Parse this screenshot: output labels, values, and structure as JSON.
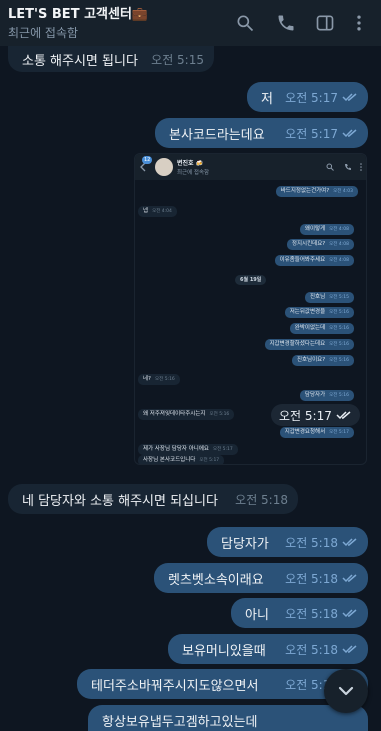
{
  "header": {
    "title": "LET'S BET 고객센터💼",
    "status": "최근에 접속함",
    "icons": [
      "search-icon",
      "phone-icon",
      "sidebar-toggle-icon",
      "more-vert-icon"
    ]
  },
  "messages": [
    {
      "text": "소통 해주시면 됩니다",
      "time": "오전 5:15",
      "dir": "in"
    },
    {
      "text": "저",
      "time": "오전 5:17",
      "dir": "out",
      "read": true
    },
    {
      "text": "본사코드라는데요",
      "time": "오전 5:17",
      "dir": "out",
      "read": true
    },
    {
      "text": "네 담당자와 소통 해주시면 되십니다",
      "time": "오전 5:18",
      "dir": "in"
    },
    {
      "text": "담당자가",
      "time": "오전 5:18",
      "dir": "out",
      "read": true
    },
    {
      "text": "렛츠벳소속이래요",
      "time": "오전 5:18",
      "dir": "out",
      "read": true
    },
    {
      "text": "아니",
      "time": "오전 5:18",
      "dir": "out",
      "read": true
    },
    {
      "text": "보유머니있을때",
      "time": "오전 5:18",
      "dir": "out",
      "read": true
    },
    {
      "text": "테더주소바꿔주시지도않으면서",
      "time": "오전 5:18",
      "dir": "out",
      "read": true
    },
    {
      "text": "항상보유냅두고겜하고있는데",
      "time": "",
      "dir": "out",
      "read": false
    }
  ],
  "screenshot_message": {
    "time": "오전 5:17",
    "header_name": "변진호 🍻",
    "header_status": "최근에 접속함",
    "avatar_badge": "12",
    "date_label": "6월 19일",
    "items": [
      {
        "text": "바드지정없는건가여?",
        "time": "오전 4:03",
        "dir": "o"
      },
      {
        "text": "넵",
        "time": "오전 4:04",
        "dir": "i"
      },
      {
        "text": "왜이렇게",
        "time": "오전 4:08",
        "dir": "o"
      },
      {
        "text": "정지시킨데요?",
        "time": "오전 4:08",
        "dir": "o"
      },
      {
        "text": "이유좀들어봐주세요",
        "time": "오전 4:08",
        "dir": "o"
      },
      {
        "text": "진호님",
        "time": "오전 5:15",
        "dir": "o"
      },
      {
        "text": "저는뒤값변경을",
        "time": "오전 5:16",
        "dir": "o"
      },
      {
        "text": "완박이없는데",
        "time": "오전 5:16",
        "dir": "o"
      },
      {
        "text": "지갑변경할하셨다는데요",
        "time": "오전 5:16",
        "dir": "o"
      },
      {
        "text": "진호님이요?",
        "time": "오전 5:16",
        "dir": "o"
      },
      {
        "text": "네?",
        "time": "오전 5:16",
        "dir": "i"
      },
      {
        "text": "담당자가",
        "time": "오전 5:16",
        "dir": "o"
      },
      {
        "text": "왜 저주져잊데이타주시는지",
        "time": "오전 5:16",
        "dir": "i"
      },
      {
        "text": "지갑변경요청해서",
        "time": "오전 5:17",
        "dir": "o"
      },
      {
        "text": "제가 사장님 담당자 아니에요",
        "time": "오전 5:17",
        "dir": "i"
      },
      {
        "text": "사장님 본사코드입니다",
        "time": "오전 5:17",
        "dir": "i"
      }
    ]
  },
  "colors": {
    "background": "#0e1621",
    "header": "#17212b",
    "incoming_bubble": "#182533",
    "outgoing_bubble": "#2b5278",
    "time_outgoing": "#7da8d3",
    "time_incoming": "#6d7f8f"
  },
  "scroll_button_icon": "chevron-down-icon"
}
